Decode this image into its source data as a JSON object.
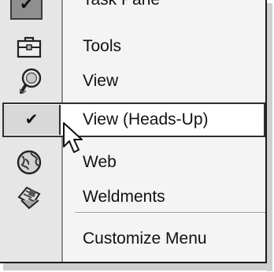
{
  "menu": {
    "items": [
      {
        "label": "Task Pane",
        "icon": "task-pane-icon",
        "checked": true
      },
      {
        "label": "Tools",
        "icon": "toolbox-icon",
        "checked": false
      },
      {
        "label": "View",
        "icon": "magnifier-icon",
        "checked": false
      },
      {
        "label": "View (Heads-Up)",
        "icon": "checkmark-icon",
        "checked": true,
        "highlighted": true
      },
      {
        "label": "Web",
        "icon": "globe-icon",
        "checked": false
      },
      {
        "label": "Weldments",
        "icon": "weldment-icon",
        "checked": false
      }
    ],
    "customize_label": "Customize Menu",
    "check_glyph": "✔"
  }
}
